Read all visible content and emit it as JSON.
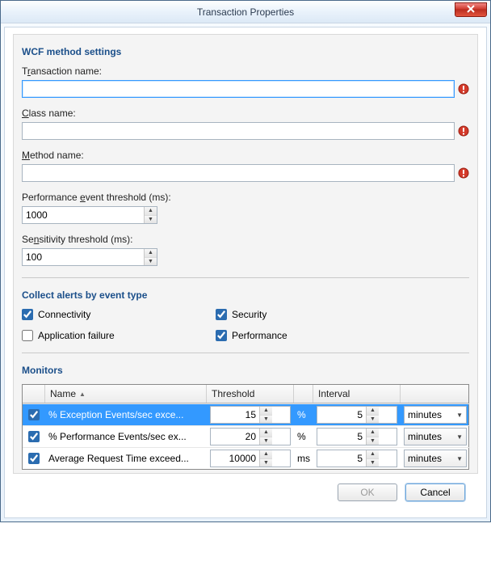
{
  "window": {
    "title": "Transaction Properties"
  },
  "section_wcf": {
    "title": "WCF method settings"
  },
  "fields": {
    "transaction_name": {
      "label_pre": "T",
      "label_key": "r",
      "label_post": "ansaction name:",
      "value": "",
      "error": true
    },
    "class_name": {
      "label_pre": "",
      "label_key": "C",
      "label_post": "lass name:",
      "value": "",
      "error": true
    },
    "method_name": {
      "label_pre": "",
      "label_key": "M",
      "label_post": "ethod name:",
      "value": "",
      "error": true
    },
    "perf_threshold": {
      "label_pre": "Performance ",
      "label_key": "e",
      "label_post": "vent threshold (ms):",
      "value": "1000"
    },
    "sens_threshold": {
      "label_pre": "Se",
      "label_key": "n",
      "label_post": "sitivity threshold (ms):",
      "value": "100"
    }
  },
  "section_alerts": {
    "title": "Collect alerts by event type"
  },
  "alerts": {
    "connectivity": {
      "label": "Connectivity",
      "checked": true
    },
    "security": {
      "label": "Security",
      "checked": true
    },
    "app_failure": {
      "label": "Application failure",
      "checked": false
    },
    "performance": {
      "label": "Performance",
      "checked": true
    }
  },
  "section_monitors": {
    "title": "Monitors"
  },
  "monitors_table": {
    "headers": {
      "name": "Name",
      "threshold": "Threshold",
      "interval": "Interval"
    },
    "rows": [
      {
        "checked": true,
        "name": "% Exception Events/sec exce...",
        "threshold": "15",
        "unit": "%",
        "interval": "5",
        "interval_unit": "minutes",
        "selected": true
      },
      {
        "checked": true,
        "name": "% Performance Events/sec ex...",
        "threshold": "20",
        "unit": "%",
        "interval": "5",
        "interval_unit": "minutes",
        "selected": false
      },
      {
        "checked": true,
        "name": "Average Request Time exceed...",
        "threshold": "10000",
        "unit": "ms",
        "interval": "5",
        "interval_unit": "minutes",
        "selected": false
      }
    ]
  },
  "buttons": {
    "ok": "OK",
    "cancel": "Cancel",
    "ok_enabled": false
  }
}
